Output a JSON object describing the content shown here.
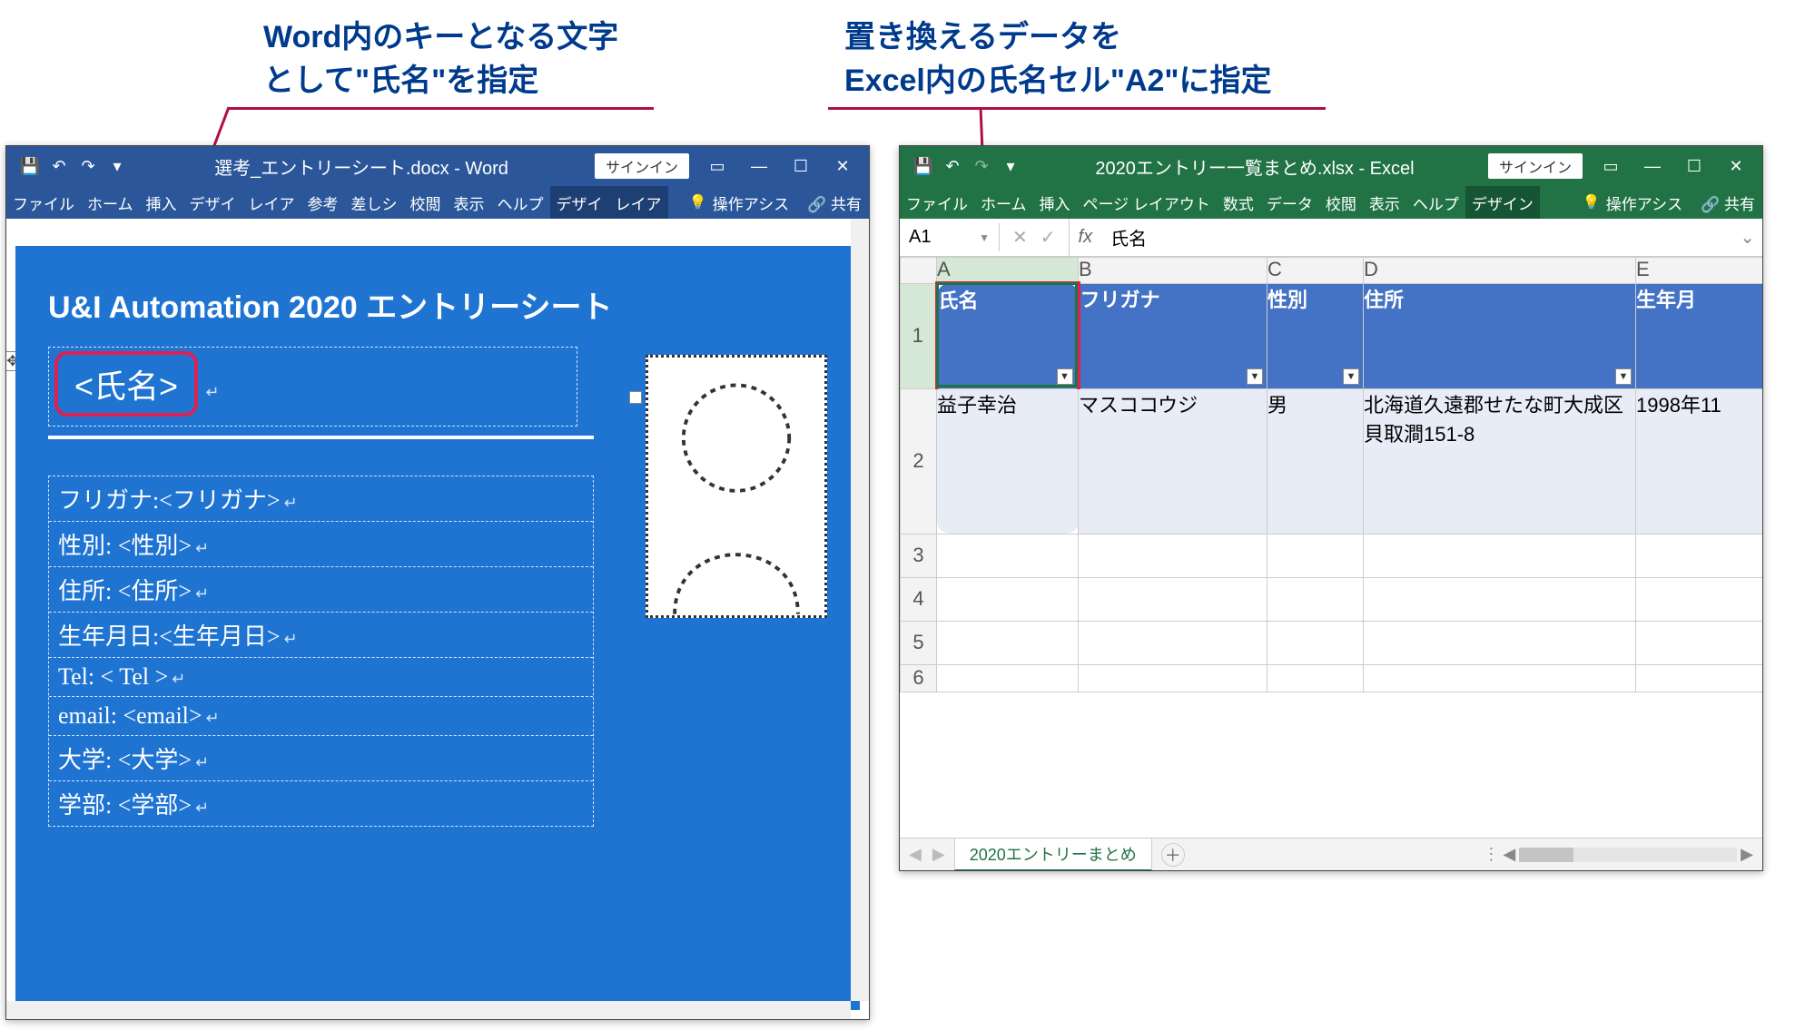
{
  "callouts": {
    "left_line1": "Word内のキーとなる文字",
    "left_line2": "として\"氏名\"を指定",
    "right_line1": "置き換えるデータを",
    "right_line2": "Excel内の氏名セル\"A2\"に指定"
  },
  "word": {
    "title": "選考_エントリーシート.docx - Word",
    "signin": "サインイン",
    "tabs": [
      "ファイル",
      "ホーム",
      "挿入",
      "デザイ",
      "レイア",
      "参考",
      "差しシ",
      "校閲",
      "表示",
      "ヘルプ",
      "デザイ",
      "レイア"
    ],
    "tell_me": "操作アシス",
    "share": "共有",
    "doc_title": "U&I Automation 2020 エントリーシート",
    "shimei_placeholder": "<氏名>",
    "fields": [
      "フリガナ:<フリガナ>",
      "性別: <性別>",
      "住所: <住所>",
      "生年月日:<生年月日>",
      "Tel: < Tel >",
      "email: <email>",
      "大学: <大学>",
      "学部: <学部>"
    ]
  },
  "excel": {
    "title": "2020エントリー一覧まとめ.xlsx - Excel",
    "signin": "サインイン",
    "tabs": [
      "ファイル",
      "ホーム",
      "挿入",
      "ページ レイアウト",
      "数式",
      "データ",
      "校閲",
      "表示",
      "ヘルプ",
      "デザイン"
    ],
    "tell_me": "操作アシス",
    "share": "共有",
    "name_box": "A1",
    "formula_value": "氏名",
    "columns": [
      "A",
      "B",
      "C",
      "D",
      "E"
    ],
    "headers": [
      "氏名",
      "フリガナ",
      "性別",
      "住所",
      "生年月"
    ],
    "row2": [
      "益子幸治",
      "マスココウジ",
      "男",
      "北海道久遠郡せたな町大成区貝取澗151-8",
      "1998年11"
    ],
    "visible_row_numbers": [
      "1",
      "2",
      "3",
      "4",
      "5",
      "6"
    ],
    "sheet_name": "2020エントリーまとめ"
  }
}
